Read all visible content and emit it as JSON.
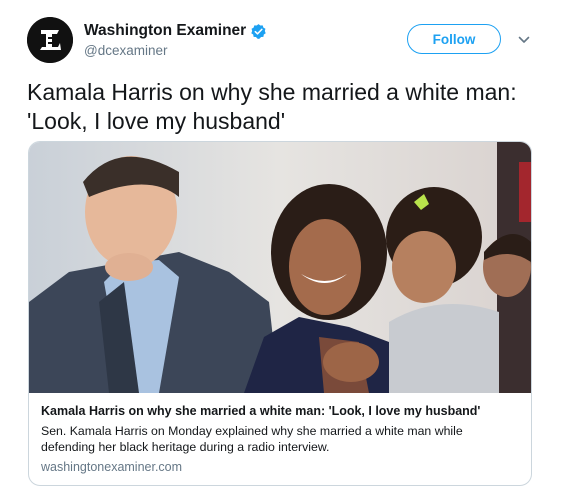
{
  "account": {
    "display_name": "Washington Examiner",
    "handle": "@dcexaminer",
    "verified": true,
    "avatar_icon": "washington-examiner-logo"
  },
  "actions": {
    "follow_label": "Follow",
    "more_icon": "chevron-down-icon"
  },
  "tweet": {
    "text": "Kamala Harris on why she married a white man: 'Look, I love my husband'"
  },
  "card": {
    "image_icon": "news-photo",
    "title": "Kamala Harris on why she married a white man: 'Look, I love my husband'",
    "description": "Sen. Kamala Harris on Monday explained why she married a white man while defending her black heritage during a radio interview.",
    "domain": "washingtonexaminer.com"
  },
  "colors": {
    "accent": "#1da1f2",
    "text": "#14171a",
    "secondary_text": "#657786",
    "border": "#ccd6dd"
  }
}
